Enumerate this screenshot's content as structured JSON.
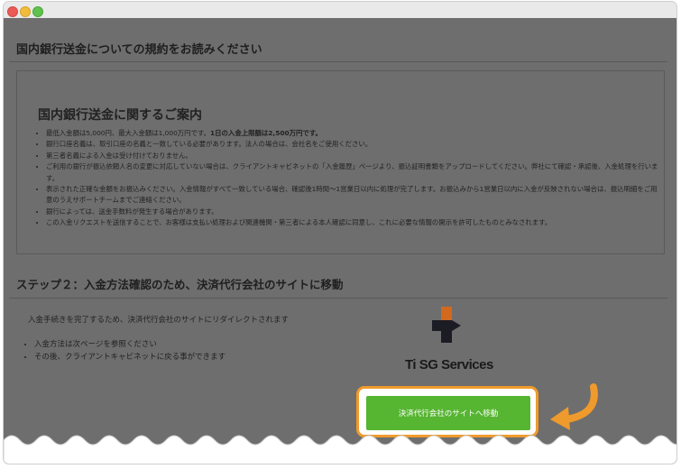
{
  "window": {
    "controls": [
      "close",
      "minimize",
      "maximize"
    ]
  },
  "header": {
    "title": "国内銀行送金についての規約をお読みください"
  },
  "notice": {
    "title": "国内銀行送金に関するご案内",
    "items": [
      {
        "text": "最低入金額は5,000円、最大入金額は1,000万円です。",
        "bold": "1日の入金上限額は2,500万円です。"
      },
      {
        "text": "銀行口座名義は、取引口座の名義と一致している必要があります。法人の場合は、会社名をご使用ください。",
        "bold": ""
      },
      {
        "text": "第三者名義による入金は受け付けておりません。",
        "bold": ""
      },
      {
        "text": "ご利用の銀行が振込依頼人名の変更に対応していない場合は、クライアントキャビネットの「入金履歴」ページより、振込証明書類をアップロードしてください。弊社にて確認・承認後、入金処理を行います。",
        "bold": ""
      },
      {
        "text": "表示された正確な金額をお振込みください。入金情報がすべて一致している場合、確認後1時間〜1営業日以内に処理が完了します。お振込みから1営業日以内に入金が反映されない場合は、振込明細をご用意のうえサポートチームまでご連絡ください。",
        "bold": ""
      },
      {
        "text": "銀行によっては、送金手数料が発生する場合があります。",
        "bold": ""
      },
      {
        "text": "この入金リクエストを送信することで、お客様は支払い処理および関連機関・第三者による本人確認に同意し、これに必要な情報の開示を許可したものとみなされます。",
        "bold": ""
      }
    ]
  },
  "step2": {
    "title": "ステップ２：入金方法確認のため、決済代行会社のサイトに移動",
    "description": "入金手続きを完了するため、決済代行会社のサイトにリダイレクトされます",
    "bullets": [
      "入金方法は次ページを参照ください",
      "その後、クライアントキャビネットに戻る事ができます"
    ],
    "logo_text": "Ti SG Services",
    "button_label": "決済代行会社のサイトへ移動"
  },
  "colors": {
    "overlay": "#6e6e6e",
    "button": "#56b531",
    "highlight": "#ef9a2c"
  },
  "icons": [
    "close-icon",
    "minimize-icon",
    "maximize-icon",
    "company-logo-icon",
    "pointer-arrow-icon"
  ]
}
